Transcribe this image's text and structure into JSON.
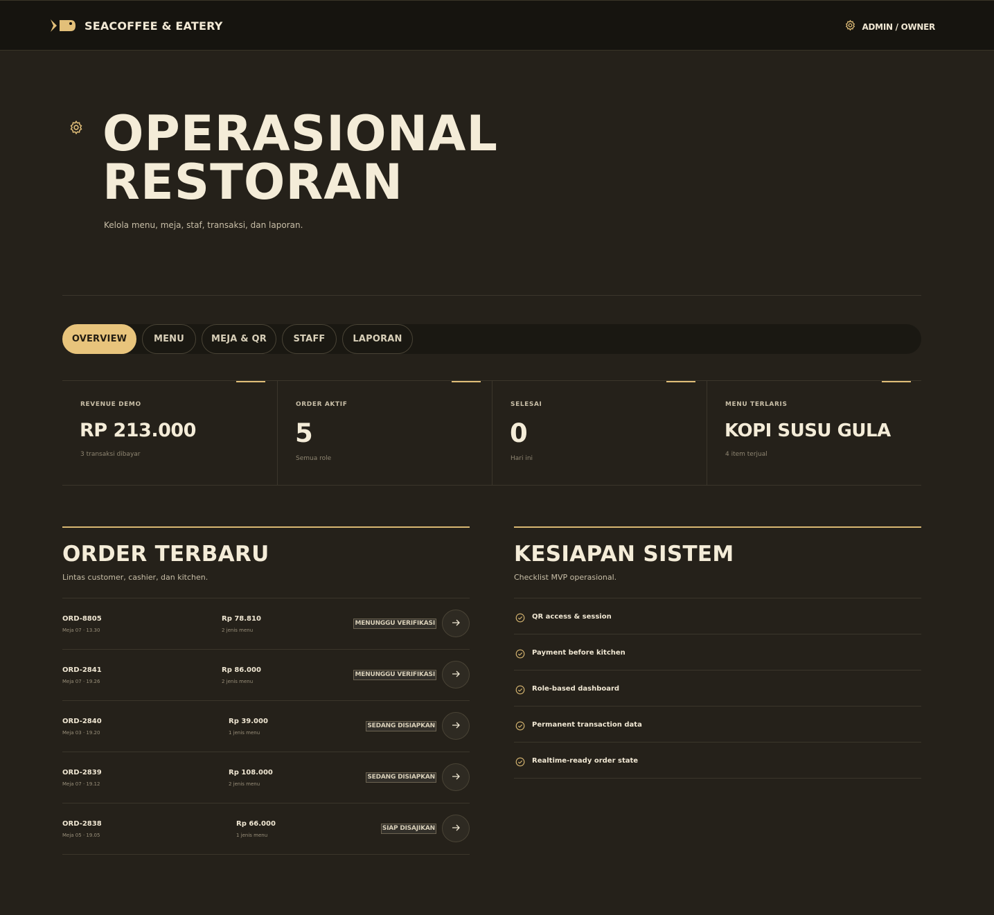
{
  "brand": {
    "name": "SEACOFFEE & EATERY",
    "logo_icon": "fish-logo-icon"
  },
  "header": {
    "role_label": "ADMIN / OWNER",
    "role_icon": "gear-icon"
  },
  "hero": {
    "icon": "gear-icon",
    "title_line1": "OPERASIONAL",
    "title_line2": "RESTORAN",
    "subtitle": "Kelola menu, meja, staf, transaksi, dan laporan."
  },
  "tabs": [
    {
      "label": "OVERVIEW",
      "active": true
    },
    {
      "label": "MENU",
      "active": false
    },
    {
      "label": "MEJA & QR",
      "active": false
    },
    {
      "label": "STAFF",
      "active": false
    },
    {
      "label": "LAPORAN",
      "active": false
    }
  ],
  "stats": [
    {
      "label": "REVENUE DEMO",
      "value": "RP 213.000",
      "note": "3 transaksi dibayar"
    },
    {
      "label": "ORDER AKTIF",
      "value": "5",
      "note": "Semua role"
    },
    {
      "label": "SELESAI",
      "value": "0",
      "note": "Hari ini"
    },
    {
      "label": "MENU TERLARIS",
      "value": "KOPI SUSU GULA",
      "note": "4 item terjual"
    }
  ],
  "orders_panel": {
    "title": "ORDER TERBARU",
    "subtitle": "Lintas customer, cashier, dan kitchen.",
    "orders": [
      {
        "id": "ORD-8805",
        "meta": "Meja 07 · 13.30",
        "amount": "Rp 78.810",
        "items": "2 jenis menu",
        "status": "MENUNGGU VERIFIKASI"
      },
      {
        "id": "ORD-2841",
        "meta": "Meja 07 · 19.26",
        "amount": "Rp 86.000",
        "items": "2 jenis menu",
        "status": "MENUNGGU VERIFIKASI"
      },
      {
        "id": "ORD-2840",
        "meta": "Meja 03 · 19.20",
        "amount": "Rp 39.000",
        "items": "1 jenis menu",
        "status": "SEDANG DISIAPKAN"
      },
      {
        "id": "ORD-2839",
        "meta": "Meja 07 · 19.12",
        "amount": "Rp 108.000",
        "items": "2 jenis menu",
        "status": "SEDANG DISIAPKAN"
      },
      {
        "id": "ORD-2838",
        "meta": "Meja 05 · 19.05",
        "amount": "Rp 66.000",
        "items": "1 jenis menu",
        "status": "SIAP DISAJIKAN"
      }
    ]
  },
  "system_panel": {
    "title": "KESIAPAN SISTEM",
    "subtitle": "Checklist MVP operasional.",
    "checks": [
      {
        "label": "QR access & session"
      },
      {
        "label": "Payment before kitchen"
      },
      {
        "label": "Role-based dashboard"
      },
      {
        "label": "Permanent transaction data"
      },
      {
        "label": "Realtime-ready order state"
      }
    ]
  },
  "colors": {
    "background": "#25211a",
    "topbar": "#16140f",
    "accent": "#e8c47c",
    "text": "#f4ecd8",
    "muted": "#c9bfa8"
  }
}
